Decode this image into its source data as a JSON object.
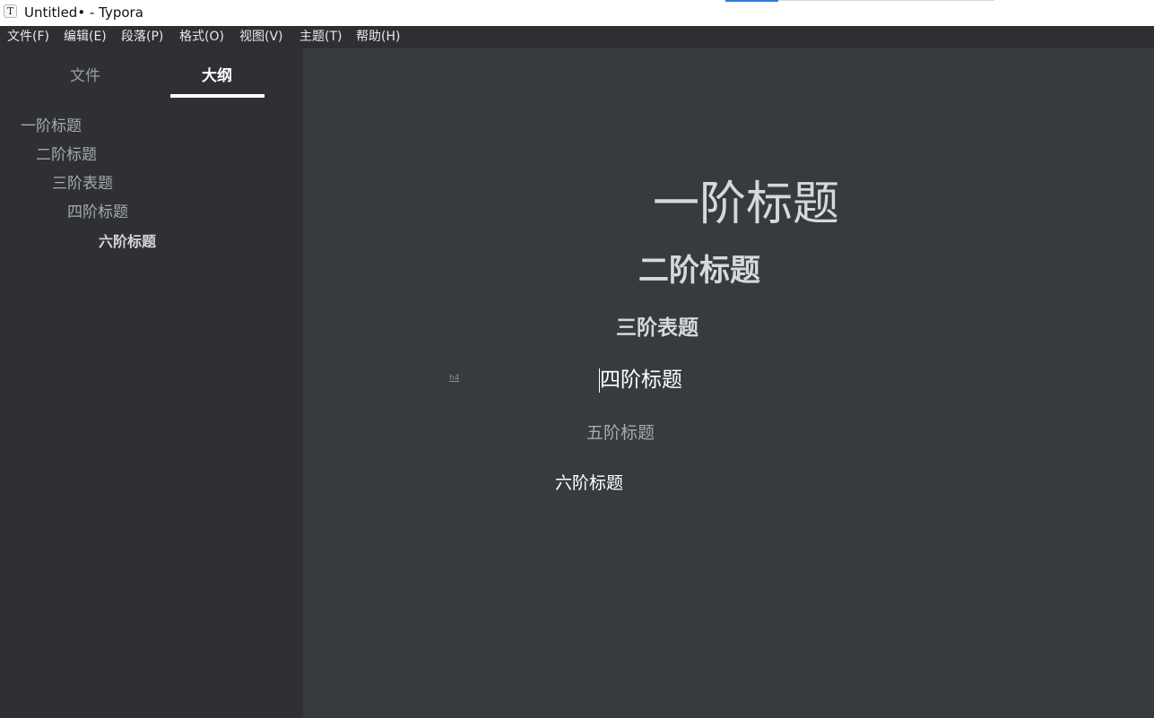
{
  "window": {
    "title": "Untitled• - Typora",
    "app_icon_glyph": "T",
    "app_icon_name": "typora-app-icon"
  },
  "menu": {
    "items": [
      "文件(F)",
      "编辑(E)",
      "段落(P)",
      "格式(O)",
      "视图(V)",
      "主题(T)",
      "帮助(H)"
    ]
  },
  "sidebar": {
    "tabs": [
      {
        "label": "文件",
        "active": false
      },
      {
        "label": "大纲",
        "active": true
      }
    ],
    "outline": [
      {
        "label": "一阶标题",
        "level": 1,
        "active": false
      },
      {
        "label": "二阶标题",
        "level": 2,
        "active": false
      },
      {
        "label": "三阶表题",
        "level": 3,
        "active": false
      },
      {
        "label": "四阶标题",
        "level": 4,
        "active": false
      },
      {
        "label": "六阶标题",
        "level": 6,
        "active": true
      }
    ]
  },
  "editor": {
    "headings": [
      {
        "text": "一阶标题",
        "level": 1
      },
      {
        "text": "二阶标题",
        "level": 2
      },
      {
        "text": "三阶表题",
        "level": 3
      },
      {
        "text": "四阶标题",
        "level": 4
      },
      {
        "text": "五阶标题",
        "level": 5
      },
      {
        "text": "六阶标题",
        "level": 6
      }
    ],
    "heading_marker": "h4"
  },
  "colors": {
    "editor_background": "#363b40",
    "sidebar_background": "#2e3033",
    "menu_background": "#2e2f33",
    "heading_text": "#d6d8da",
    "muted_text": "#a6a9ad"
  }
}
